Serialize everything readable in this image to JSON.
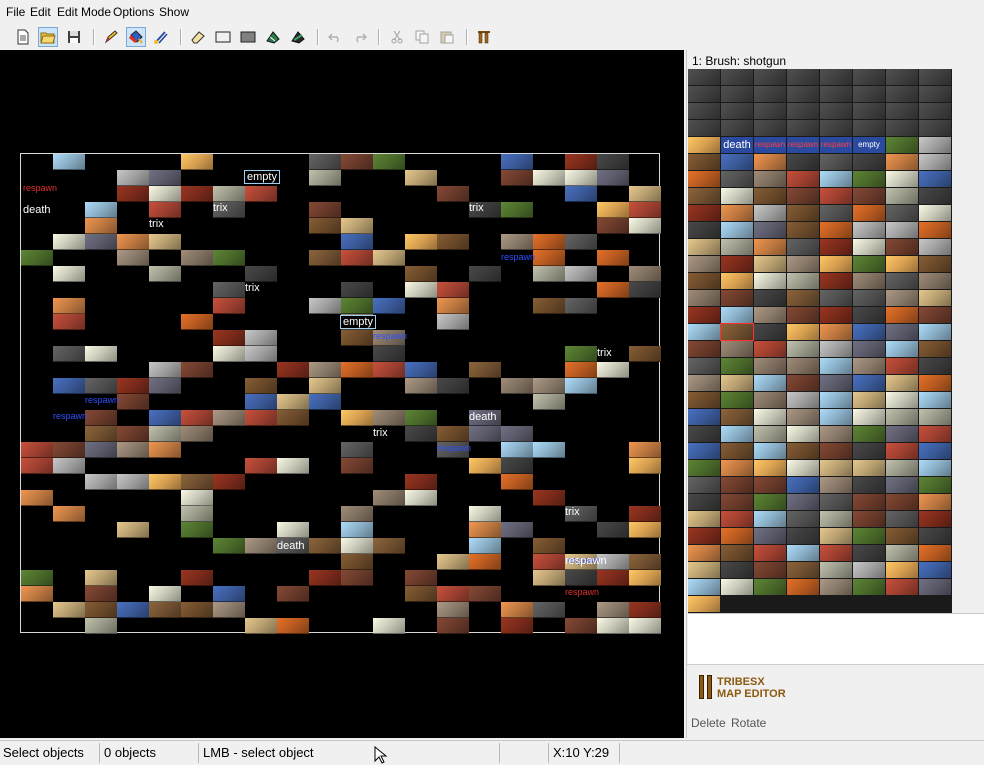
{
  "menu": [
    "File",
    "Edit",
    "Edit Mode",
    "Options",
    "Show"
  ],
  "toolbar": {
    "buttons": [
      {
        "name": "new-file-icon",
        "active": false,
        "disabled": false
      },
      {
        "name": "open-folder-icon",
        "active": true,
        "disabled": false
      },
      {
        "name": "save-icon",
        "active": false,
        "disabled": false
      },
      {
        "name": "pencil-icon",
        "active": false,
        "disabled": false
      },
      {
        "name": "fill-bucket-icon",
        "active": true,
        "disabled": false
      },
      {
        "name": "brush-stroke-icon",
        "active": false,
        "disabled": false
      },
      {
        "name": "eraser-icon",
        "active": false,
        "disabled": false
      },
      {
        "name": "rectangle-outline-icon",
        "active": false,
        "disabled": false
      },
      {
        "name": "rectangle-filled-icon",
        "active": false,
        "disabled": false
      },
      {
        "name": "stamp-icon",
        "active": false,
        "disabled": false
      },
      {
        "name": "paint-tool-icon",
        "active": false,
        "disabled": false
      },
      {
        "name": "undo-icon",
        "active": false,
        "disabled": true
      },
      {
        "name": "redo-icon",
        "active": false,
        "disabled": true
      },
      {
        "name": "cut-icon",
        "active": false,
        "disabled": true
      },
      {
        "name": "copy-icon",
        "active": false,
        "disabled": true
      },
      {
        "name": "paste-icon",
        "active": false,
        "disabled": true
      },
      {
        "name": "tribes-logo-icon",
        "active": false,
        "disabled": false
      }
    ]
  },
  "panel": {
    "title": "1: Brush: shotgun",
    "logo_line1": "TRIBESX",
    "logo_line2": "MAP EDITOR",
    "actions": [
      "Delete",
      "Rotate"
    ]
  },
  "map_labels": [
    {
      "text": "respawn",
      "color": "#e03030"
    },
    {
      "text": "death",
      "color": "#ffffff"
    },
    {
      "text": "empty",
      "color": "#ffffff"
    },
    {
      "text": "trix",
      "color": "#ffffff"
    },
    {
      "text": "respawn",
      "color": "#3050ff"
    },
    {
      "text": "empty",
      "color": "#ffffff"
    },
    {
      "text": "trix",
      "color": "#ffffff"
    },
    {
      "text": "trix",
      "color": "#ffffff"
    },
    {
      "text": "respawn",
      "color": "#3050ff"
    },
    {
      "text": "respawn",
      "color": "#3050ff"
    },
    {
      "text": "respawn",
      "color": "#3050ff"
    },
    {
      "text": "respawn",
      "color": "#3050ff"
    },
    {
      "text": "trix",
      "color": "#ffffff"
    },
    {
      "text": "trix",
      "color": "#ffffff"
    },
    {
      "text": "death",
      "color": "#ffffff"
    },
    {
      "text": "trix",
      "color": "#ffffff"
    },
    {
      "text": "respawn",
      "color": "#3050ff"
    },
    {
      "text": "respawn",
      "color": "#ffffff"
    },
    {
      "text": "respawn",
      "color": "#e03030"
    },
    {
      "text": "death",
      "color": "#ffffff"
    },
    {
      "text": "trix",
      "color": "#ffffff"
    }
  ],
  "palette_labels": [
    "death",
    "respawn",
    "respawn",
    "respawn",
    "empty"
  ],
  "tile_colors": [
    "#6b4a2a",
    "#8a7a6a",
    "#b85a20",
    "#a0a0a0",
    "#4a6a2a",
    "#7a2a1a",
    "#c07840",
    "#5a5a6a",
    "#9a9a8a",
    "#3a5a9a",
    "#b8a070",
    "#6a3a2a",
    "#8ab0c8",
    "#c8c8b8",
    "#705030",
    "#505050",
    "#a04030",
    "#d8a050",
    "#3a3a3a",
    "#807060"
  ],
  "status": {
    "mode": "Select objects",
    "count": "0 objects",
    "hint": "LMB - select object",
    "blank": "",
    "coords": "X:10 Y:29"
  }
}
